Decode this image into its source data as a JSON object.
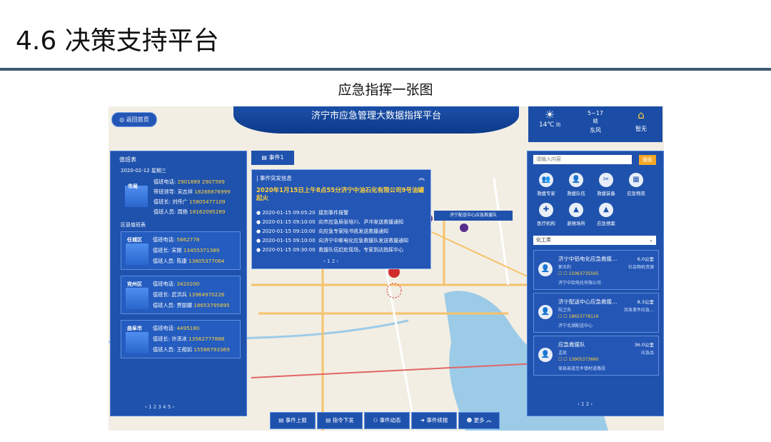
{
  "slide": {
    "title": "4.6 决策支持平台",
    "subtitle": "应急指挥一张图"
  },
  "platform": {
    "title": "济宁市应急管理大数据指挥平台",
    "back_label": "返回首页"
  },
  "weather": {
    "temp": "14℃",
    "temp_unit": "阴",
    "date": "5~17",
    "condition": "晴",
    "wind": "东风",
    "alert": "暂无"
  },
  "duty": {
    "title": "值班表",
    "date": "2020-02-12 星期三",
    "city": {
      "name": "市局",
      "phone_label": "值班电话:",
      "phone": "2901889  2907589",
      "leader_label": "带班领导:",
      "leader": "宋志祥",
      "leader_phone": "18266876999",
      "chief_label": "值班长:",
      "chief": "刘传广",
      "chief_phone": "15805477109",
      "staff_label": "值班人员:",
      "staff": "周扬",
      "staff_phone": "18162095289"
    },
    "district_title": "区县值班表",
    "districts": [
      {
        "name": "任城区",
        "phone_label": "值班电话:",
        "phone": "5662778",
        "chief_label": "值班长:",
        "chief": "宋刚",
        "chief_phone": "13455371389",
        "staff_label": "值班人员:",
        "staff": "陈康",
        "staff_phone": "13805377064"
      },
      {
        "name": "兖州区",
        "phone_label": "值班电话:",
        "phone": "3420200",
        "chief_label": "值班长:",
        "chief": "武洪兵",
        "chief_phone": "13964970226",
        "staff_label": "值班人员:",
        "staff": "贾丽娜",
        "staff_phone": "18653795695"
      },
      {
        "name": "曲阜市",
        "phone_label": "值班电话:",
        "phone": "4495180",
        "chief_label": "值班长:",
        "chief": "许泽冰",
        "chief_phone": "13562777888",
        "staff_label": "值班人员:",
        "staff": "王相如",
        "staff_phone": "15588793369"
      }
    ],
    "pager": "‹  1  2  3  4  5  ›"
  },
  "event": {
    "tab": "事件1",
    "header": "事件突发信息",
    "headline": "2020年1月15日上午8点55分济宁中油石化有限公司9号油罐起火",
    "items": [
      {
        "time": "2020-01-15 09:05:20",
        "text": "接到事件报警"
      },
      {
        "time": "2020-01-15 09:10:00",
        "text": "向市应急局张培川、尹冲发送救援通知"
      },
      {
        "time": "2020-01-15 09:10:00",
        "text": "向应急专家陆书凯发送救援通知"
      },
      {
        "time": "2020-01-15 09:10:00",
        "text": "向济宁中邮电化应急救援队发送救援通知"
      },
      {
        "time": "2020-01-15 09:30:00",
        "text": "救援队伍赶赴现场，专家到达指挥中心"
      }
    ],
    "pager": "‹  1  2  ›",
    "map_tag": "济宁配送中心应急救援队"
  },
  "resources": {
    "search_placeholder": "请输入内容",
    "search_btn": "搜索",
    "icons": [
      {
        "label": "救援专家",
        "glyph": "👥"
      },
      {
        "label": "救援队伍",
        "glyph": "👤"
      },
      {
        "label": "救援装备",
        "glyph": "✂"
      },
      {
        "label": "应急物资",
        "glyph": "▦"
      },
      {
        "label": "医疗机构",
        "glyph": "✚"
      },
      {
        "label": "避难场所",
        "glyph": "▲"
      },
      {
        "label": "应急预案",
        "glyph": "▲"
      }
    ],
    "filter": "化工类",
    "cards": [
      {
        "name": "济宁中铝电化应急救援…",
        "dist": "6.0公里",
        "person": "郭玉利",
        "tag": "社会物机资源",
        "phone": "15063735595",
        "org": "济宁中铝电化有限公司"
      },
      {
        "name": "济宁配送中心应急救援…",
        "dist": "8.3公里",
        "person": "陆卫东",
        "tag": "突发事件应急…",
        "phone": "18653778116",
        "org": "济宁北湖配送中心"
      },
      {
        "name": "应急救援队",
        "dist": "36.0公里",
        "person": "孟凯",
        "tag": "应急品",
        "phone": "13905373660",
        "org": "邹县县道至乡镇村道路段"
      }
    ],
    "pager": "‹  1  2  ›"
  },
  "toolbar": [
    {
      "label": "事件上报",
      "icon": "report-icon"
    },
    {
      "label": "指令下发",
      "icon": "command-icon"
    },
    {
      "label": "事件动态",
      "icon": "dynamic-icon"
    },
    {
      "label": "事件续报",
      "icon": "continue-icon"
    },
    {
      "label": "更多  ︽",
      "icon": "more-icon"
    }
  ]
}
